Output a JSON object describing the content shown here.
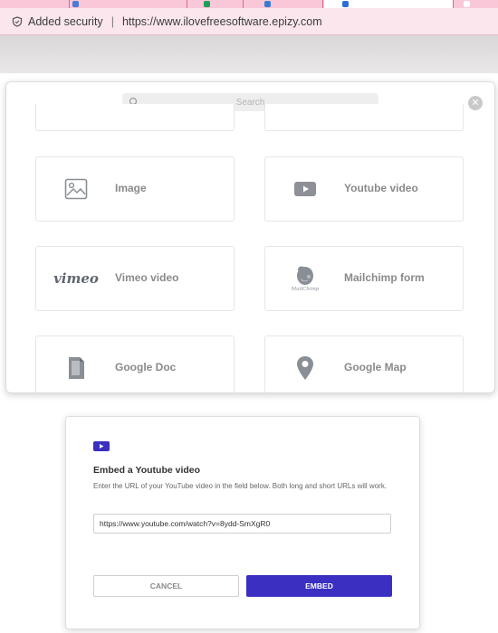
{
  "browser": {
    "security_label": "Added security",
    "separator": "|",
    "url": "https://www.ilovefreesoftware.epizy.com"
  },
  "block_picker": {
    "search_placeholder": "Search",
    "close_symbol": "✕",
    "items": [
      {
        "label": "Image",
        "icon": "image-icon"
      },
      {
        "label": "Youtube video",
        "icon": "youtube-icon"
      },
      {
        "label": "Vimeo video",
        "icon": "vimeo-logo",
        "logo_text": "vimeo"
      },
      {
        "label": "Mailchimp form",
        "icon": "mailchimp-icon",
        "logo_text": "MailChimp"
      },
      {
        "label": "Google Doc",
        "icon": "google-doc-icon"
      },
      {
        "label": "Google Map",
        "icon": "map-pin-icon"
      }
    ]
  },
  "embed_dialog": {
    "title": "Embed a Youtube video",
    "description": "Enter the URL of your YouTube video in the field below. Both long and short URLs will work.",
    "url_value": "https://www.youtube.com/watch?v=8ydd-SmXgR0",
    "cancel_label": "CANCEL",
    "embed_label": "EMBED"
  },
  "colors": {
    "accent": "#3a2fc1",
    "tab_strip": "#f9c8d8",
    "address_bar": "#fbe6ee"
  }
}
